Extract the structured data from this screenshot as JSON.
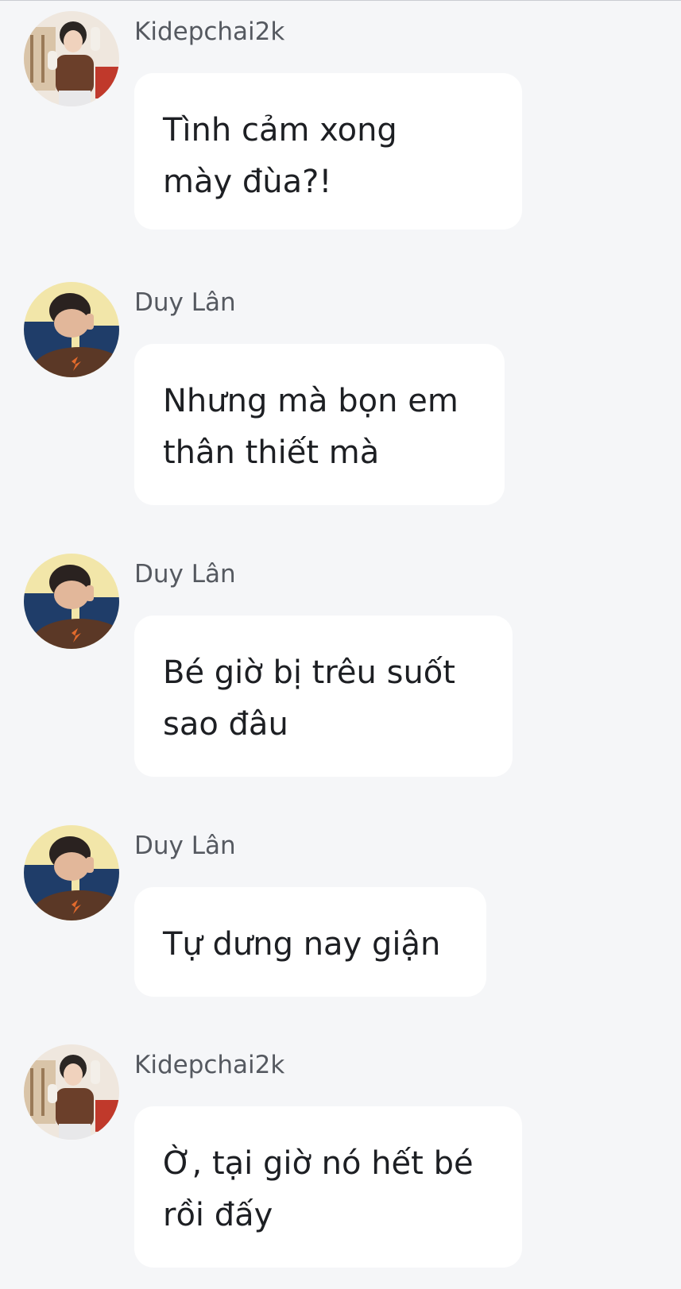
{
  "messages": [
    {
      "sender": "Kidepchai2k",
      "avatar": "kidepchai-avatar",
      "lines": [
        "Tình cảm xong",
        "mày đùa?!"
      ]
    },
    {
      "sender": "Duy Lân",
      "avatar": "duy-lan-avatar",
      "lines": [
        "Nhưng mà bọn em",
        "thân thiết mà"
      ]
    },
    {
      "sender": "Duy Lân",
      "avatar": "duy-lan-avatar",
      "lines": [
        "Bé giờ bị trêu suốt",
        "sao đâu"
      ]
    },
    {
      "sender": "Duy Lân",
      "avatar": "duy-lan-avatar",
      "lines": [
        "Tự dưng nay giận"
      ]
    },
    {
      "sender": "Kidepchai2k",
      "avatar": "kidepchai-avatar",
      "lines": [
        "Ờ, tại giờ nó hết bé",
        "rồi đấy"
      ]
    }
  ],
  "colors": {
    "background": "#f5f6f8",
    "bubble": "#ffffff",
    "sender_text": "#555960",
    "message_text": "#1d1f23"
  }
}
